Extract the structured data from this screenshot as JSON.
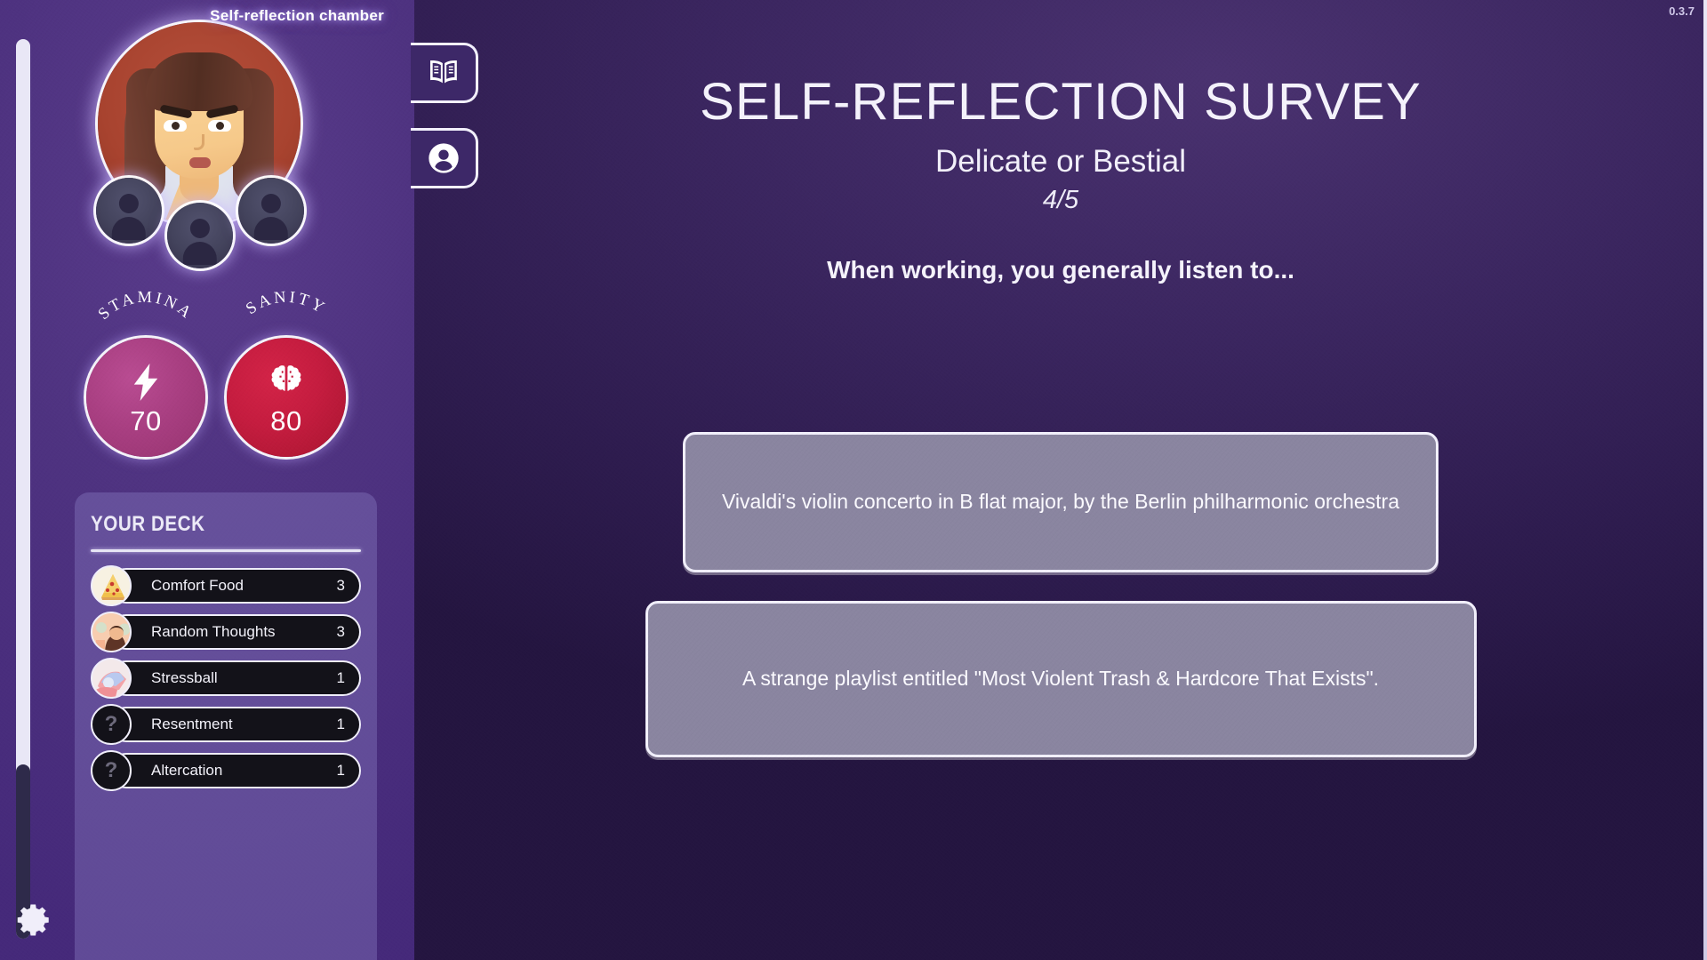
{
  "meta": {
    "version_label": "0.3.7"
  },
  "left_panel": {
    "chamber_label": "Self-reflection chamber",
    "portrait": {
      "icon": "female-character-portrait-icon"
    },
    "companions": [
      {
        "icon": "companion-silhouette-icon"
      },
      {
        "icon": "companion-silhouette-icon"
      },
      {
        "icon": "companion-silhouette-icon"
      }
    ],
    "stats": [
      {
        "name": "STAMINA",
        "value": "70",
        "icon": "lightning-bolt-icon",
        "color": "#a93f82"
      },
      {
        "name": "SANITY",
        "value": "80",
        "icon": "brain-icon",
        "color": "#c51c3f"
      }
    ],
    "deck": {
      "title": "YOUR DECK",
      "items": [
        {
          "name": "Comfort Food",
          "count": "3",
          "icon": "pizza-slice-icon",
          "avatar_class": "av-pizza",
          "glyph": ""
        },
        {
          "name": "Random Thoughts",
          "count": "3",
          "icon": "thinking-person-icon",
          "avatar_class": "av-thoughts",
          "glyph": ""
        },
        {
          "name": "Stressball",
          "count": "1",
          "icon": "hands-stressball-icon",
          "avatar_class": "av-stress",
          "glyph": ""
        },
        {
          "name": "Resentment",
          "count": "1",
          "icon": "question-mark-icon",
          "avatar_class": "av-unknown",
          "glyph": "?"
        },
        {
          "name": "Altercation",
          "count": "1",
          "icon": "question-mark-icon",
          "avatar_class": "av-unknown",
          "glyph": "?"
        }
      ]
    },
    "settings_button": {
      "icon": "gear-icon"
    }
  },
  "main_panel": {
    "side_tabs": [
      {
        "id": "journal",
        "icon": "open-book-icon"
      },
      {
        "id": "profile",
        "icon": "person-icon"
      }
    ],
    "survey": {
      "title": "SELF-REFLECTION SURVEY",
      "subtitle": "Delicate or Bestial",
      "progress": "4/5",
      "question": "When working, you generally listen to...",
      "answers": [
        "Vivaldi's violin concerto in B flat major, by the Berlin philharmonic orchestra",
        "A strange playlist entitled \"Most Violent Trash & Hardcore That Exists\"."
      ]
    }
  },
  "colors": {
    "left_panel_bg": "#4e3280",
    "main_panel_bg": "#3b2660",
    "stamina": "#a93f82",
    "sanity": "#c51c3f",
    "answer_button": "#8a85a0",
    "outline": "#f1effb"
  }
}
